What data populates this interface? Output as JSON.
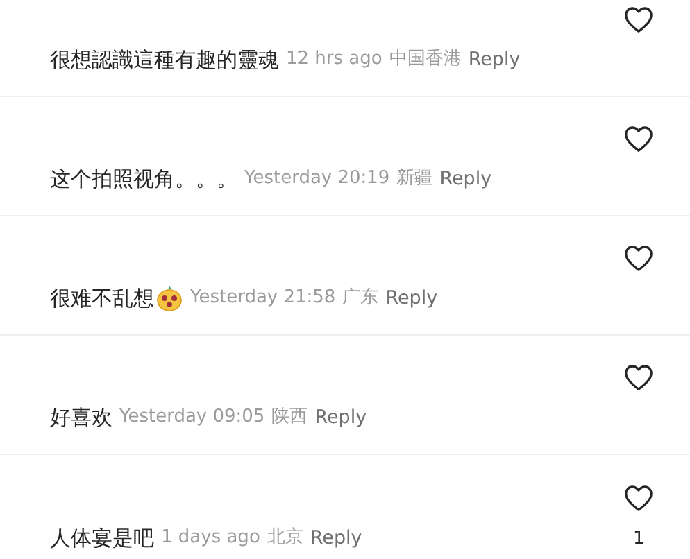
{
  "comments": [
    {
      "text": "很想認識這種有趣的靈魂",
      "sticker": false,
      "time": "12 hrs ago",
      "location": "中国香港",
      "reply": "Reply"
    },
    {
      "text": "这个拍照视角。。。",
      "sticker": false,
      "time": "Yesterday 20:19",
      "location": "新疆",
      "reply": "Reply"
    },
    {
      "text": "很难不乱想",
      "sticker": true,
      "time": "Yesterday 21:58",
      "location": "广东",
      "reply": "Reply"
    },
    {
      "text": "好喜欢",
      "sticker": false,
      "time": "Yesterday 09:05",
      "location": "陕西",
      "reply": "Reply"
    },
    {
      "text": "人体宴是吧",
      "sticker": false,
      "time": "1 days ago",
      "location": "北京",
      "reply": "Reply",
      "likes": "1"
    }
  ]
}
